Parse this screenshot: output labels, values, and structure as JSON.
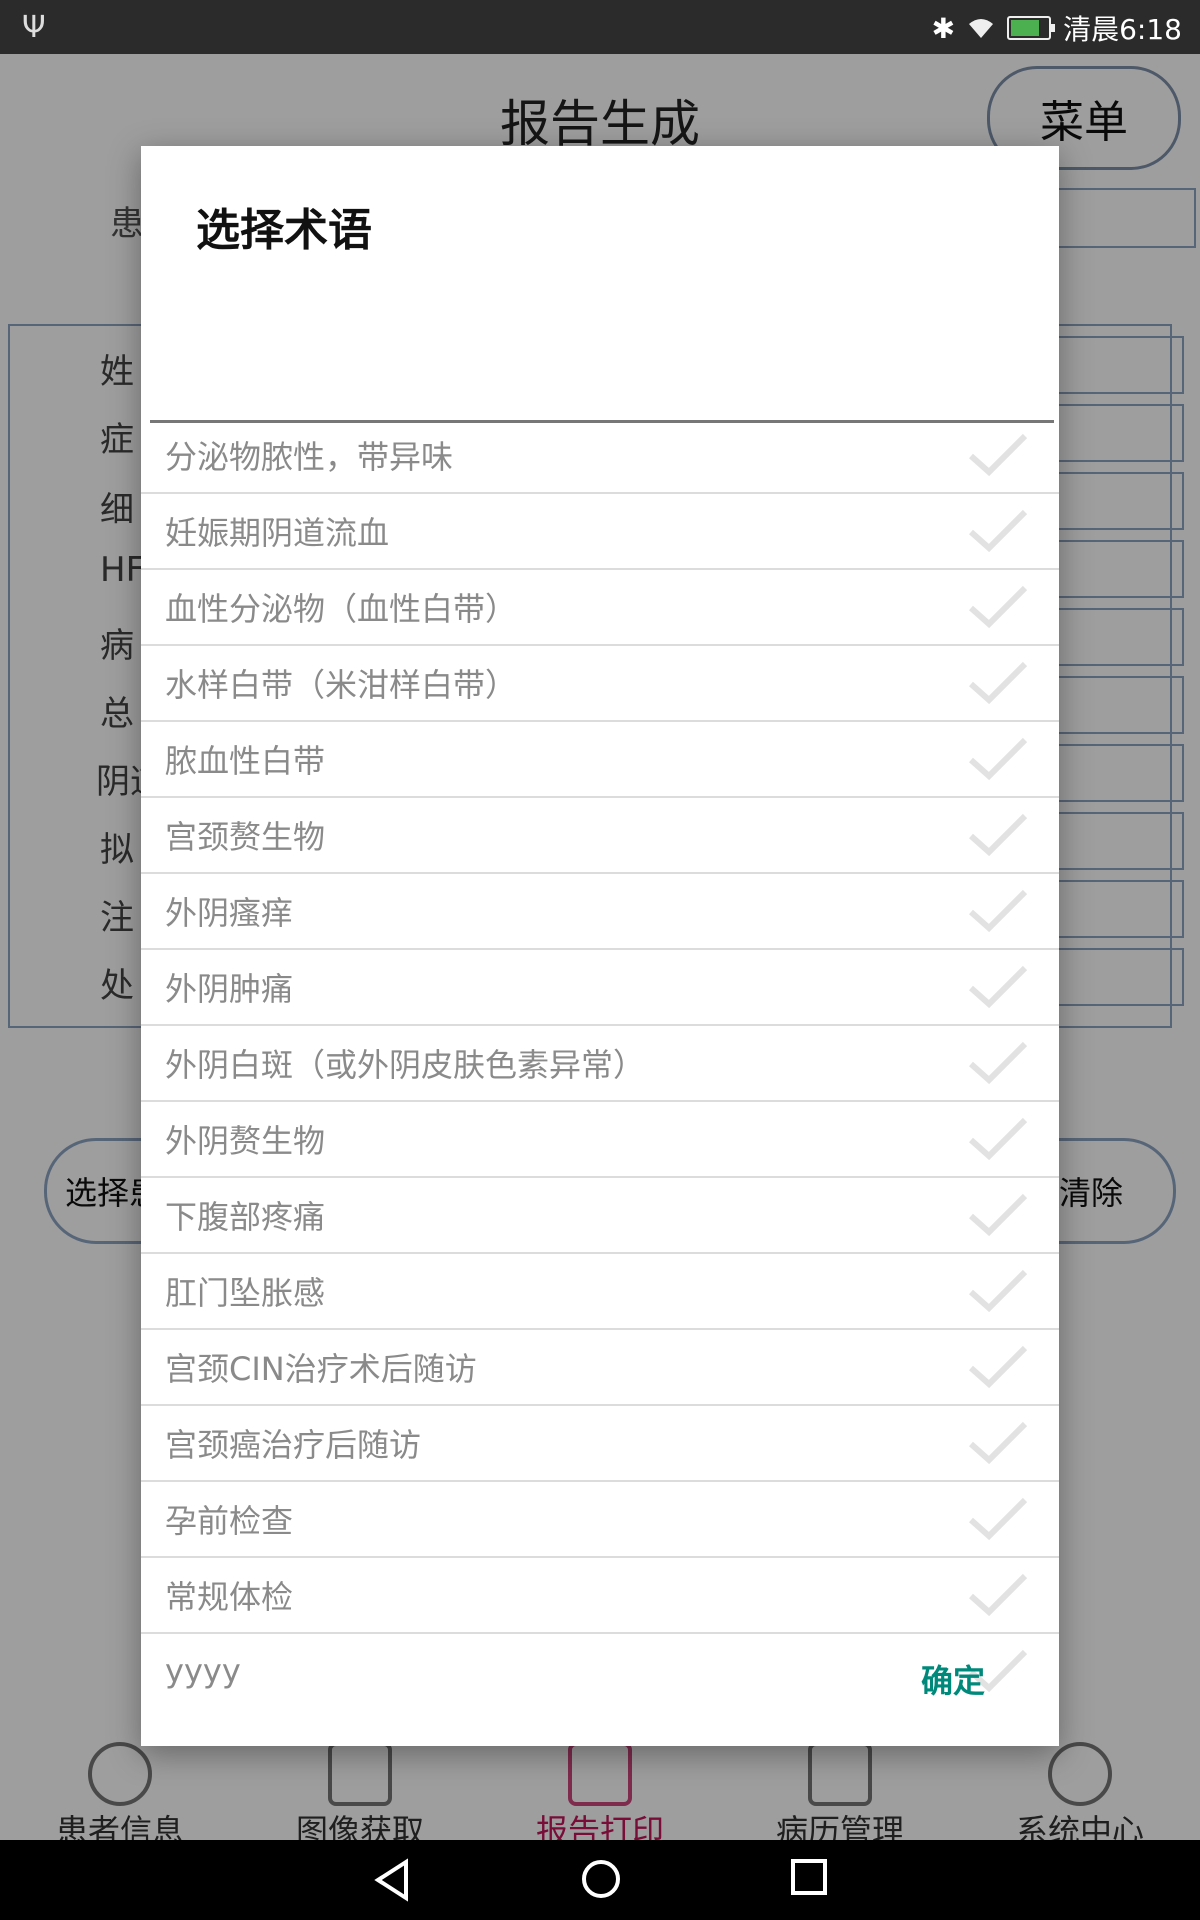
{
  "status_bar": {
    "time": "清晨6:18",
    "usb_icon": "usb-icon",
    "bluetooth_icon": "bluetooth-icon",
    "wifi_icon": "wifi-icon",
    "battery_icon": "battery-icon"
  },
  "app": {
    "title": "报告生成",
    "menu_label": "菜单",
    "patient_label": "患",
    "form_labels": [
      "姓",
      "症",
      "细",
      "HF",
      "病",
      "总",
      "阴道",
      "拟",
      "注",
      "处"
    ],
    "select_button": "选择患",
    "clear_button": "清除"
  },
  "bottom_nav": [
    {
      "label": "患者信息",
      "icon": "patient-icon"
    },
    {
      "label": "图像获取",
      "icon": "image-icon"
    },
    {
      "label": "报告打印",
      "icon": "printer-icon",
      "active": true
    },
    {
      "label": "病历管理",
      "icon": "records-icon"
    },
    {
      "label": "系统中心",
      "icon": "gear-icon"
    }
  ],
  "dialog": {
    "title": "选择术语",
    "filter_value": "",
    "items": [
      {
        "label": "分泌物脓性，带异味",
        "checked": false
      },
      {
        "label": "妊娠期阴道流血",
        "checked": false
      },
      {
        "label": "血性分泌物（血性白带）",
        "checked": false
      },
      {
        "label": "水样白带（米泔样白带）",
        "checked": false
      },
      {
        "label": "脓血性白带",
        "checked": false
      },
      {
        "label": "宫颈赘生物",
        "checked": false
      },
      {
        "label": "外阴瘙痒",
        "checked": false
      },
      {
        "label": "外阴肿痛",
        "checked": false
      },
      {
        "label": "外阴白斑（或外阴皮肤色素异常）",
        "checked": false
      },
      {
        "label": "外阴赘生物",
        "checked": false
      },
      {
        "label": "下腹部疼痛",
        "checked": false
      },
      {
        "label": "肛门坠胀感",
        "checked": false
      },
      {
        "label": "宫颈CIN治疗术后随访",
        "checked": false
      },
      {
        "label": "宫颈癌治疗后随访",
        "checked": false
      },
      {
        "label": "孕前检查",
        "checked": false
      },
      {
        "label": "常规体检",
        "checked": false
      },
      {
        "label": "yyyy",
        "checked": false
      }
    ],
    "ok_label": "确定",
    "accent_color": "#00897b"
  }
}
